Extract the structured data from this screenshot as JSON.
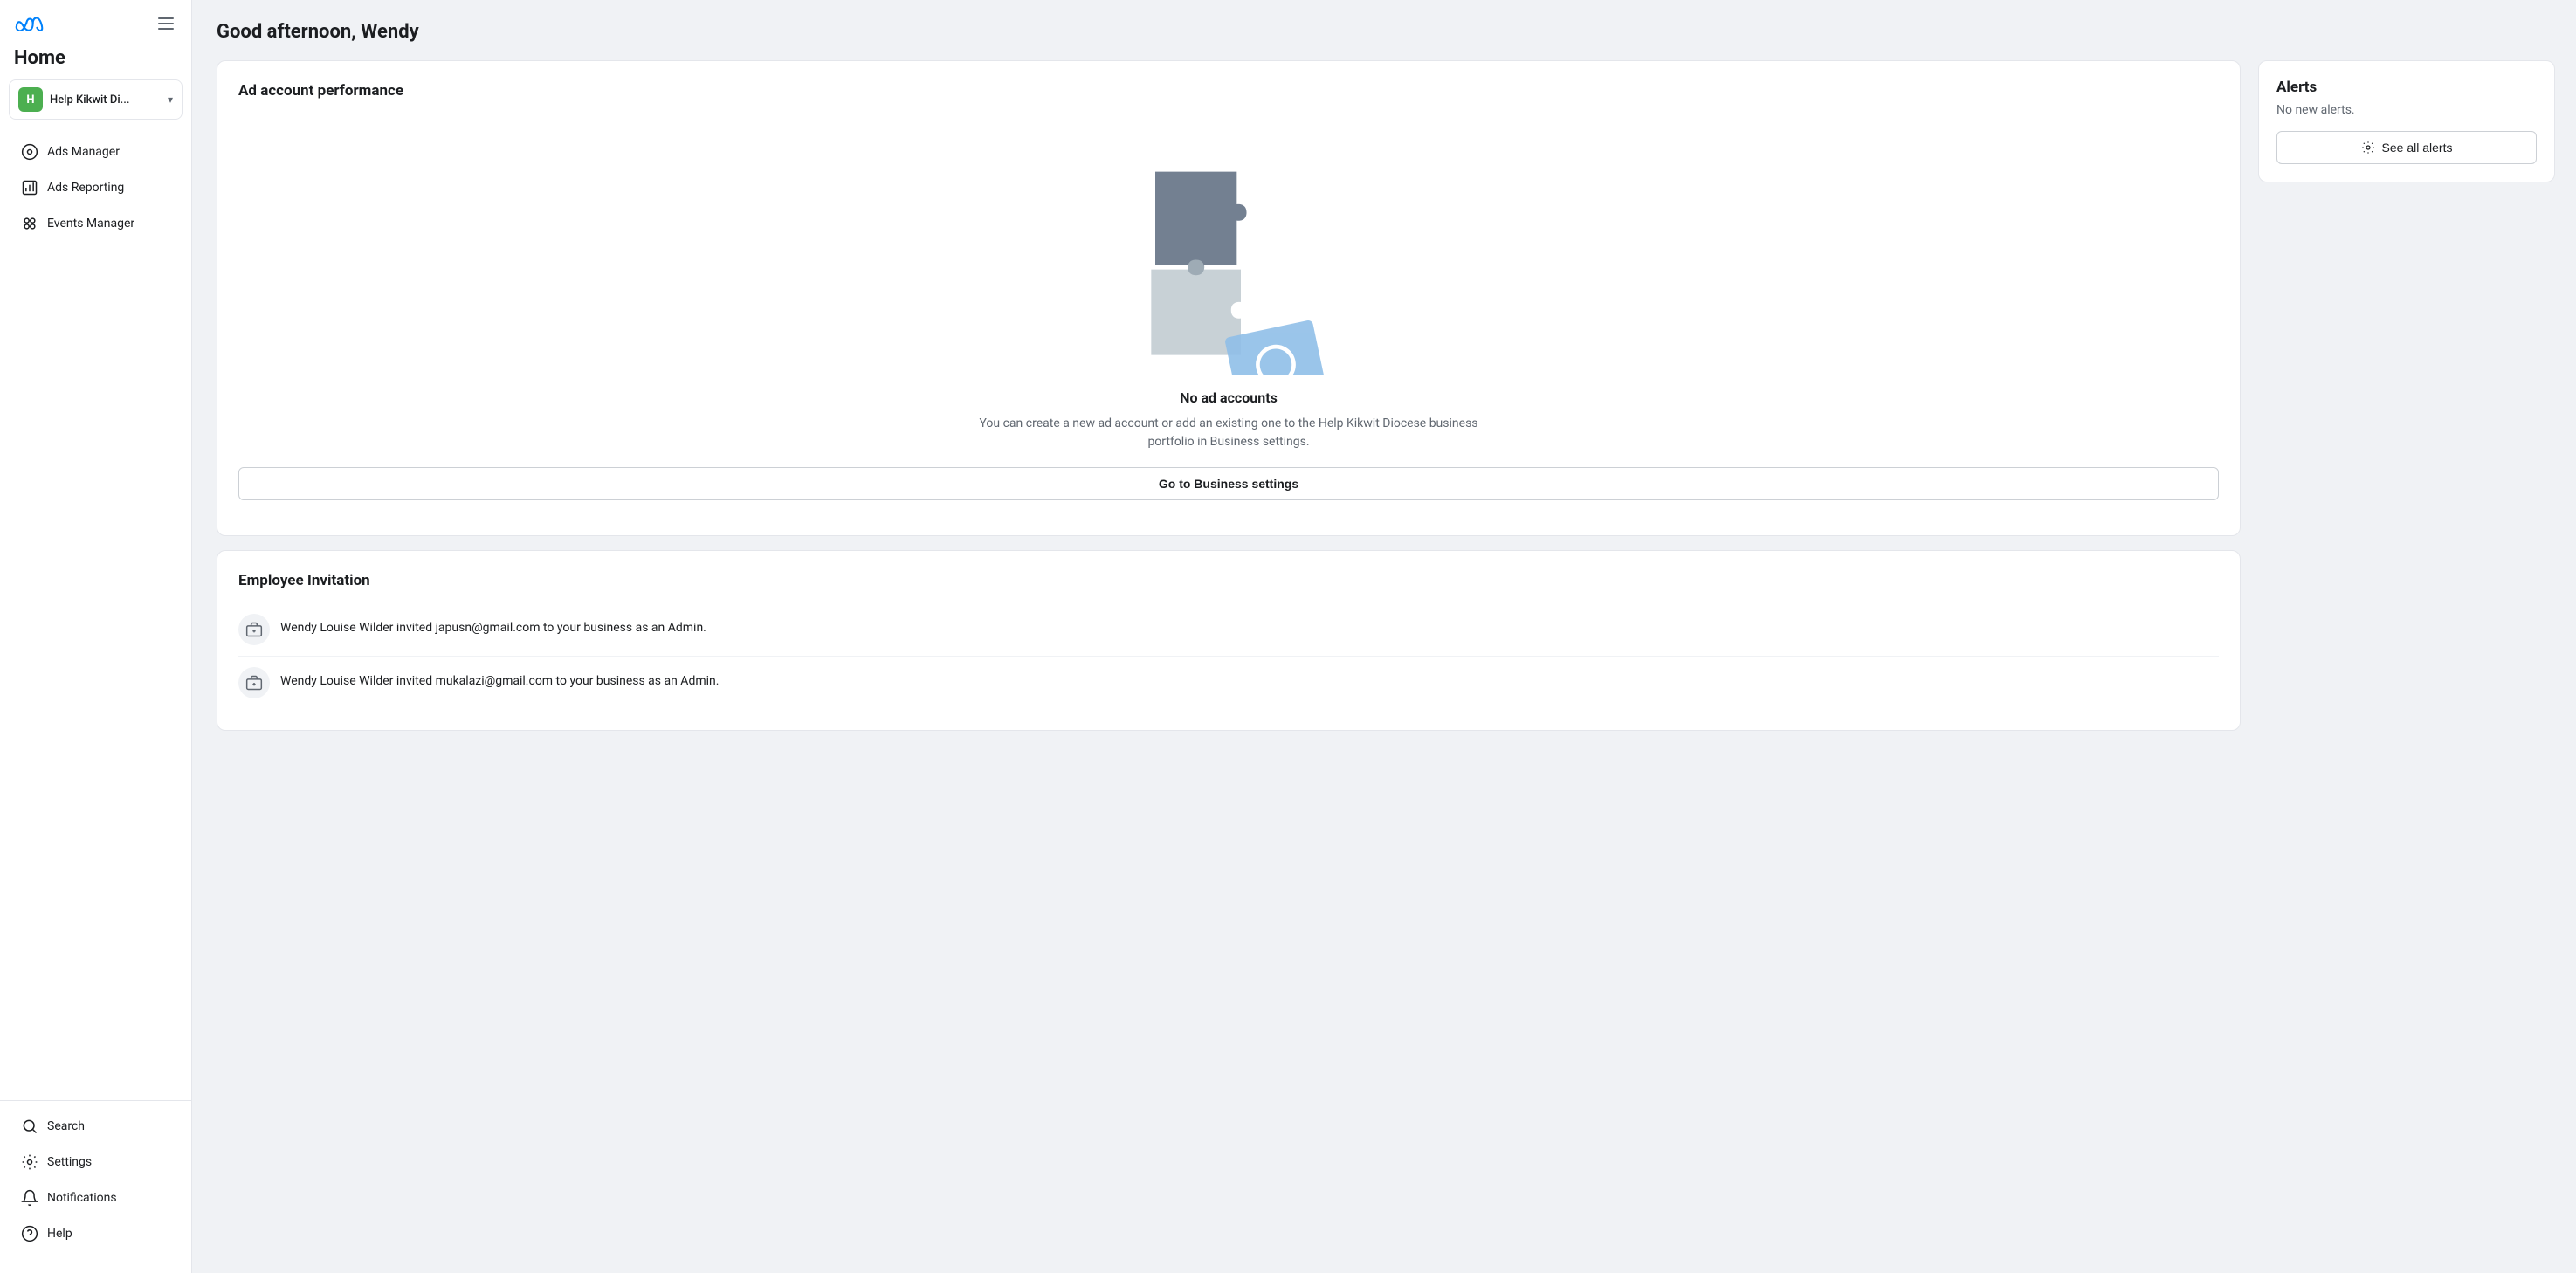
{
  "meta": {
    "logo_alt": "Meta"
  },
  "sidebar": {
    "home_label": "Home",
    "account": {
      "initial": "H",
      "name": "Help Kikwit Di...",
      "avatar_color": "#4caf50"
    },
    "nav_items": [
      {
        "id": "ads-manager",
        "label": "Ads Manager"
      },
      {
        "id": "ads-reporting",
        "label": "Ads Reporting"
      },
      {
        "id": "events-manager",
        "label": "Events Manager"
      }
    ],
    "bottom_items": [
      {
        "id": "search",
        "label": "Search"
      },
      {
        "id": "settings",
        "label": "Settings"
      },
      {
        "id": "notifications",
        "label": "Notifications"
      },
      {
        "id": "help",
        "label": "Help"
      }
    ]
  },
  "main": {
    "greeting": "Good afternoon, Wendy",
    "ad_performance": {
      "title": "Ad account performance",
      "no_accounts_title": "No ad accounts",
      "no_accounts_desc": "You can create a new ad account or add an existing one to the Help Kikwit Diocese business portfolio in Business settings.",
      "go_to_business_btn": "Go to Business settings"
    },
    "employee_invitation": {
      "title": "Employee Invitation",
      "invitations": [
        {
          "text": "Wendy Louise Wilder invited japusn@gmail.com to your business as an Admin."
        },
        {
          "text": "Wendy Louise Wilder invited mukalazi@gmail.com to your business as an Admin."
        }
      ]
    }
  },
  "alerts": {
    "title": "Alerts",
    "empty_text": "No new alerts.",
    "see_all_btn": "See all alerts",
    "gear_icon": "⚙"
  }
}
